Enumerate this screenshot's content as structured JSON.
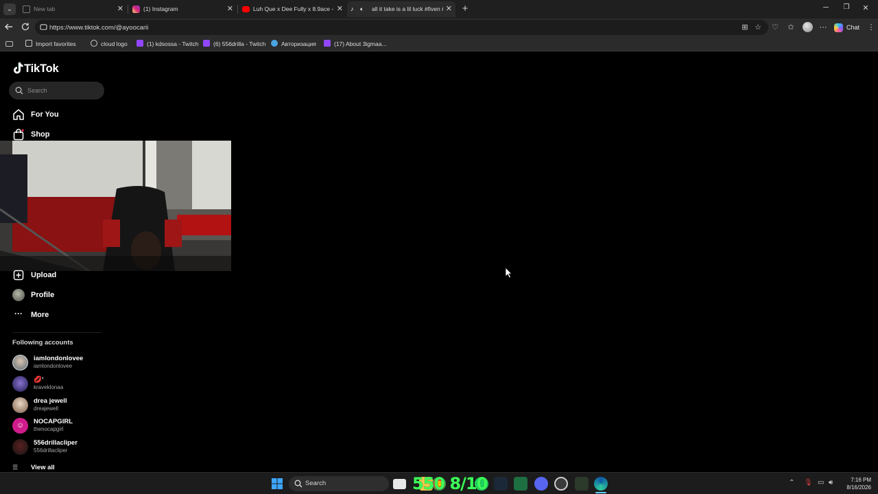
{
  "browser": {
    "tabs": [
      {
        "title": "New tab",
        "favicon": "new-tab-icon",
        "active": false,
        "dim": true
      },
      {
        "title": "(1) Instagram",
        "favicon": "instagram-icon",
        "active": false,
        "dim": false
      },
      {
        "title": "Luh Que x Dee Fully x 8.9ace - Sna",
        "favicon": "youtube-icon",
        "active": false,
        "dim": false
      },
      {
        "title": "all it take is a lil luck #fiven #",
        "favicon": "tiktok-icon",
        "active": true,
        "dim": false
      }
    ],
    "address": "https://www.tiktok.com/@ayoocarii",
    "chat_label": "Chat",
    "bookmarks": [
      {
        "label": "Import favorites",
        "icon": "import-icon"
      },
      {
        "label": "cloud logo",
        "icon": "globe-icon"
      },
      {
        "label": "(1) kdsossa - Twitch",
        "icon": "twitch-icon"
      },
      {
        "label": "(6) 556drilla - Twitch",
        "icon": "twitch-icon"
      },
      {
        "label": "Авторизация",
        "icon": "auth-icon"
      },
      {
        "label": "(17) About 3igmaa...",
        "icon": "twitch-icon"
      }
    ]
  },
  "tiktok": {
    "logo": "TikTok",
    "search_placeholder": "Search",
    "nav": {
      "for_you": "For You",
      "shop": "Shop",
      "upload": "Upload",
      "profile": "Profile",
      "more": "More"
    },
    "following_title": "Following accounts",
    "accounts": [
      {
        "name": "iamlondonlovee",
        "handle": "iamlondonlovee",
        "color": "#7a8a94"
      },
      {
        "name": "💋ʼ",
        "handle": "kraveklonaa",
        "color": "#3a3a7a"
      },
      {
        "name": "drea jewell",
        "handle": "dreajewell",
        "color": "#c9a88c"
      },
      {
        "name": "NOCAPGIRL",
        "handle": "thenocapgirl",
        "color": "#d01c8b"
      },
      {
        "name": "556drillacliper",
        "handle": "556drillacliper",
        "color": "#2a2a2a"
      }
    ],
    "view_all": "View all"
  },
  "taskbar": {
    "search_label": "Search",
    "overlay": "550 8/10",
    "time": "7:16 PM",
    "date": "8/16/2026"
  },
  "colors": {
    "page_bg": "#000000",
    "browser_chrome": "#2b2b2b",
    "tab_strip": "#1f1f1f",
    "overlay_green": "#3dff5a"
  }
}
